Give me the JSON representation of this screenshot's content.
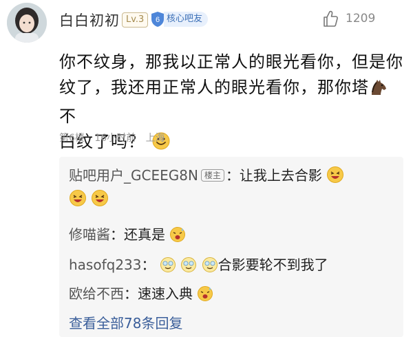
{
  "user": {
    "name": "白白初初",
    "level": "Lv.3",
    "badge_number": "6",
    "badge_label": "核心吧友"
  },
  "post": {
    "line1": "你不纹身，那我以正常人的眼光看你，但是你",
    "line2a": "纹了，我还用正常人的眼光看你，那你塔",
    "line2b": "不",
    "line3": "白纹了吗？",
    "likes": "1209"
  },
  "meta": {
    "floor": "第6楼",
    "time": "16小时前",
    "location": "上海"
  },
  "replies": [
    {
      "name": "贴吧用户_GCEEG8N",
      "tag": "楼主",
      "text": "：让我上去合影"
    },
    {
      "name": "修喵酱",
      "text": "：还真是"
    },
    {
      "name": "hasofq233",
      "text": "：",
      "text2": "合影要轮不到我了"
    },
    {
      "name": "欧给不西",
      "text": "：速速入典"
    }
  ],
  "more_replies": "查看全部78条回复",
  "colors": {
    "link": "#3a5e9a",
    "badge_blue": "#3b6fb6",
    "emoji_yellow": "#f7c948"
  },
  "icons": {
    "like": "thumbs-up-icon",
    "smile": "smile-emoji-icon",
    "horse": "horse-emoji-icon",
    "laugh": "laugh-emoji-icon",
    "cry": "cry-laugh-emoji-icon",
    "sweat": "sweat-emoji-icon"
  }
}
